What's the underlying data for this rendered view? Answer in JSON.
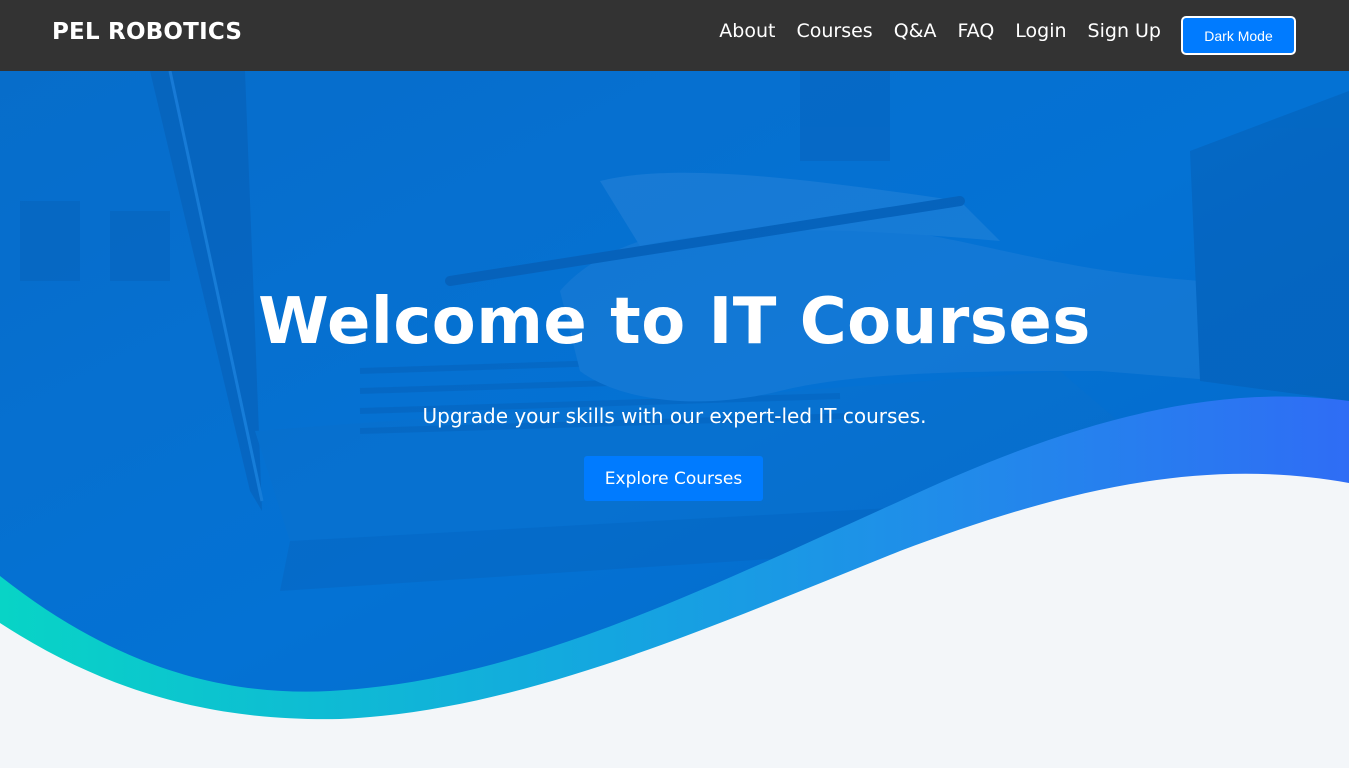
{
  "navbar": {
    "brand": "PEL ROBOTICS",
    "links": [
      "About",
      "Courses",
      "Q&A",
      "FAQ",
      "Login",
      "Sign Up"
    ],
    "dark_mode_label": "Dark Mode"
  },
  "hero": {
    "title": "Welcome to IT Courses",
    "subtitle": "Upgrade your skills with our expert-led IT courses.",
    "cta_label": "Explore Courses"
  },
  "colors": {
    "navbar_bg": "#333333",
    "hero_blue": "#0677d4",
    "button_blue": "#007bff",
    "wave_teal": "#08d4c6",
    "wave_blue": "#2f6df5",
    "page_bg": "#f3f6f9"
  }
}
